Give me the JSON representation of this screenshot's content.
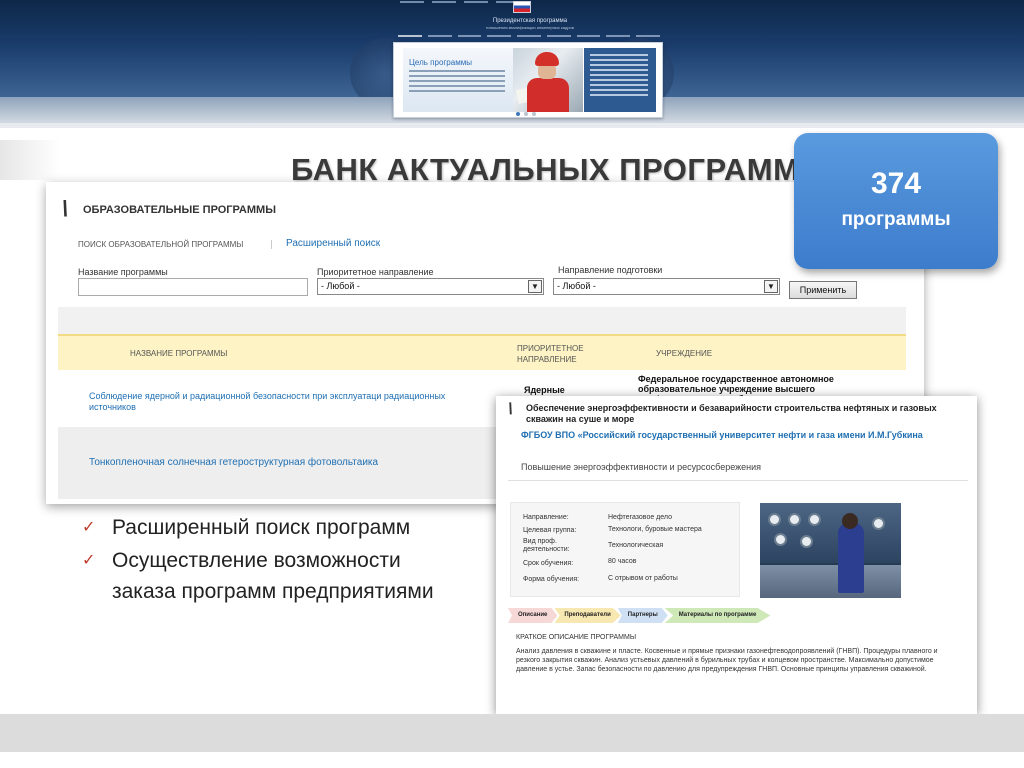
{
  "header": {
    "site_title": "Президентская программа",
    "site_subtitle": "повышения квалификации инженерных кадров",
    "slide_title": "Цель программы"
  },
  "heading": "БАНК АКТУАЛЬНЫХ ПРОГРАММ",
  "badge": {
    "count": "374",
    "label": "программы"
  },
  "catalog": {
    "title": "ОБРАЗОВАТЕЛЬНЫЕ ПРОГРАММЫ",
    "search_label": "ПОИСК ОБРАЗОВАТЕЛЬНОЙ ПРОГРАММЫ",
    "advanced_link": "Расширенный поиск",
    "name_label": "Название программы",
    "name_value": "",
    "priority_label": "Приоритетное направление",
    "priority_value": "- Любой -",
    "direction_label": "Направление подготовки",
    "direction_value": "- Любой -",
    "apply_label": "Применить",
    "columns": [
      "НАЗВАНИЕ ПРОГРАММЫ",
      "ПРИОРИТЕТНОЕ НАПРАВЛЕНИЕ",
      "УЧРЕЖДЕНИЕ"
    ],
    "rows": [
      {
        "name": "Соблюдение ядерной и радиационной безопасности при эксплуатаци  радиационных источников",
        "priority": "Ядерные",
        "institution": "Федеральное государственное автономное образовательное учреждение высшего профессионального образования"
      },
      {
        "name": "Тонкопленочная солнечная гетероструктурная фотовольтаика",
        "priority": "",
        "institution": ""
      }
    ]
  },
  "detail": {
    "title": "Обеспечение энергоэффективности и безаварийности строительства нефтяных и газовых скважин на суше и море",
    "org": "ФГБОУ ВПО «Российский государственный университет нефти и газа имени И.М.Губкина",
    "category": "Повышение энергоэффективности и ресурсосбережения",
    "fields": [
      {
        "key": "Направление:",
        "value": "Нефтегазовое дело"
      },
      {
        "key": "Целевая группа:",
        "value": "Технологи, буровые мастера"
      },
      {
        "key": "Вид проф. деятельности:",
        "value": "Технологическая"
      },
      {
        "key": "Срок обучения:",
        "value": "80 часов"
      },
      {
        "key": "Форма обучения:",
        "value": "С отрывом от работы"
      }
    ],
    "tabs": [
      {
        "label": "Описание",
        "color": "#f6d8d6"
      },
      {
        "label": "Преподаватели",
        "color": "#f7e7b0"
      },
      {
        "label": "Партнеры",
        "color": "#cfe0f5"
      },
      {
        "label": "Материалы по программе",
        "color": "#cfe8b8"
      }
    ],
    "desc_heading": "КРАТКОЕ ОПИСАНИЕ ПРОГРАММЫ",
    "desc": "Анализ давления в скважине и пласте. Косвенные и прямые признаки газонефтеводопроявлений (ГНВП). Процедуры плавного и резкого закрытия скважин. Анализ устьевых давлений в бурильных трубах и колцевом пространстве. Максимально допустимое давление в устье. Запас безопасности по давлению для предупреждения ГНВП. Основные принципы управления скважиной."
  },
  "bullets": [
    "Расширенный поиск программ",
    "Осуществление возможности заказа программ предприятиями"
  ],
  "colors": {
    "accent": "#3c7ccc",
    "link": "#1f6fb2",
    "table_head": "#fdf3c4"
  }
}
